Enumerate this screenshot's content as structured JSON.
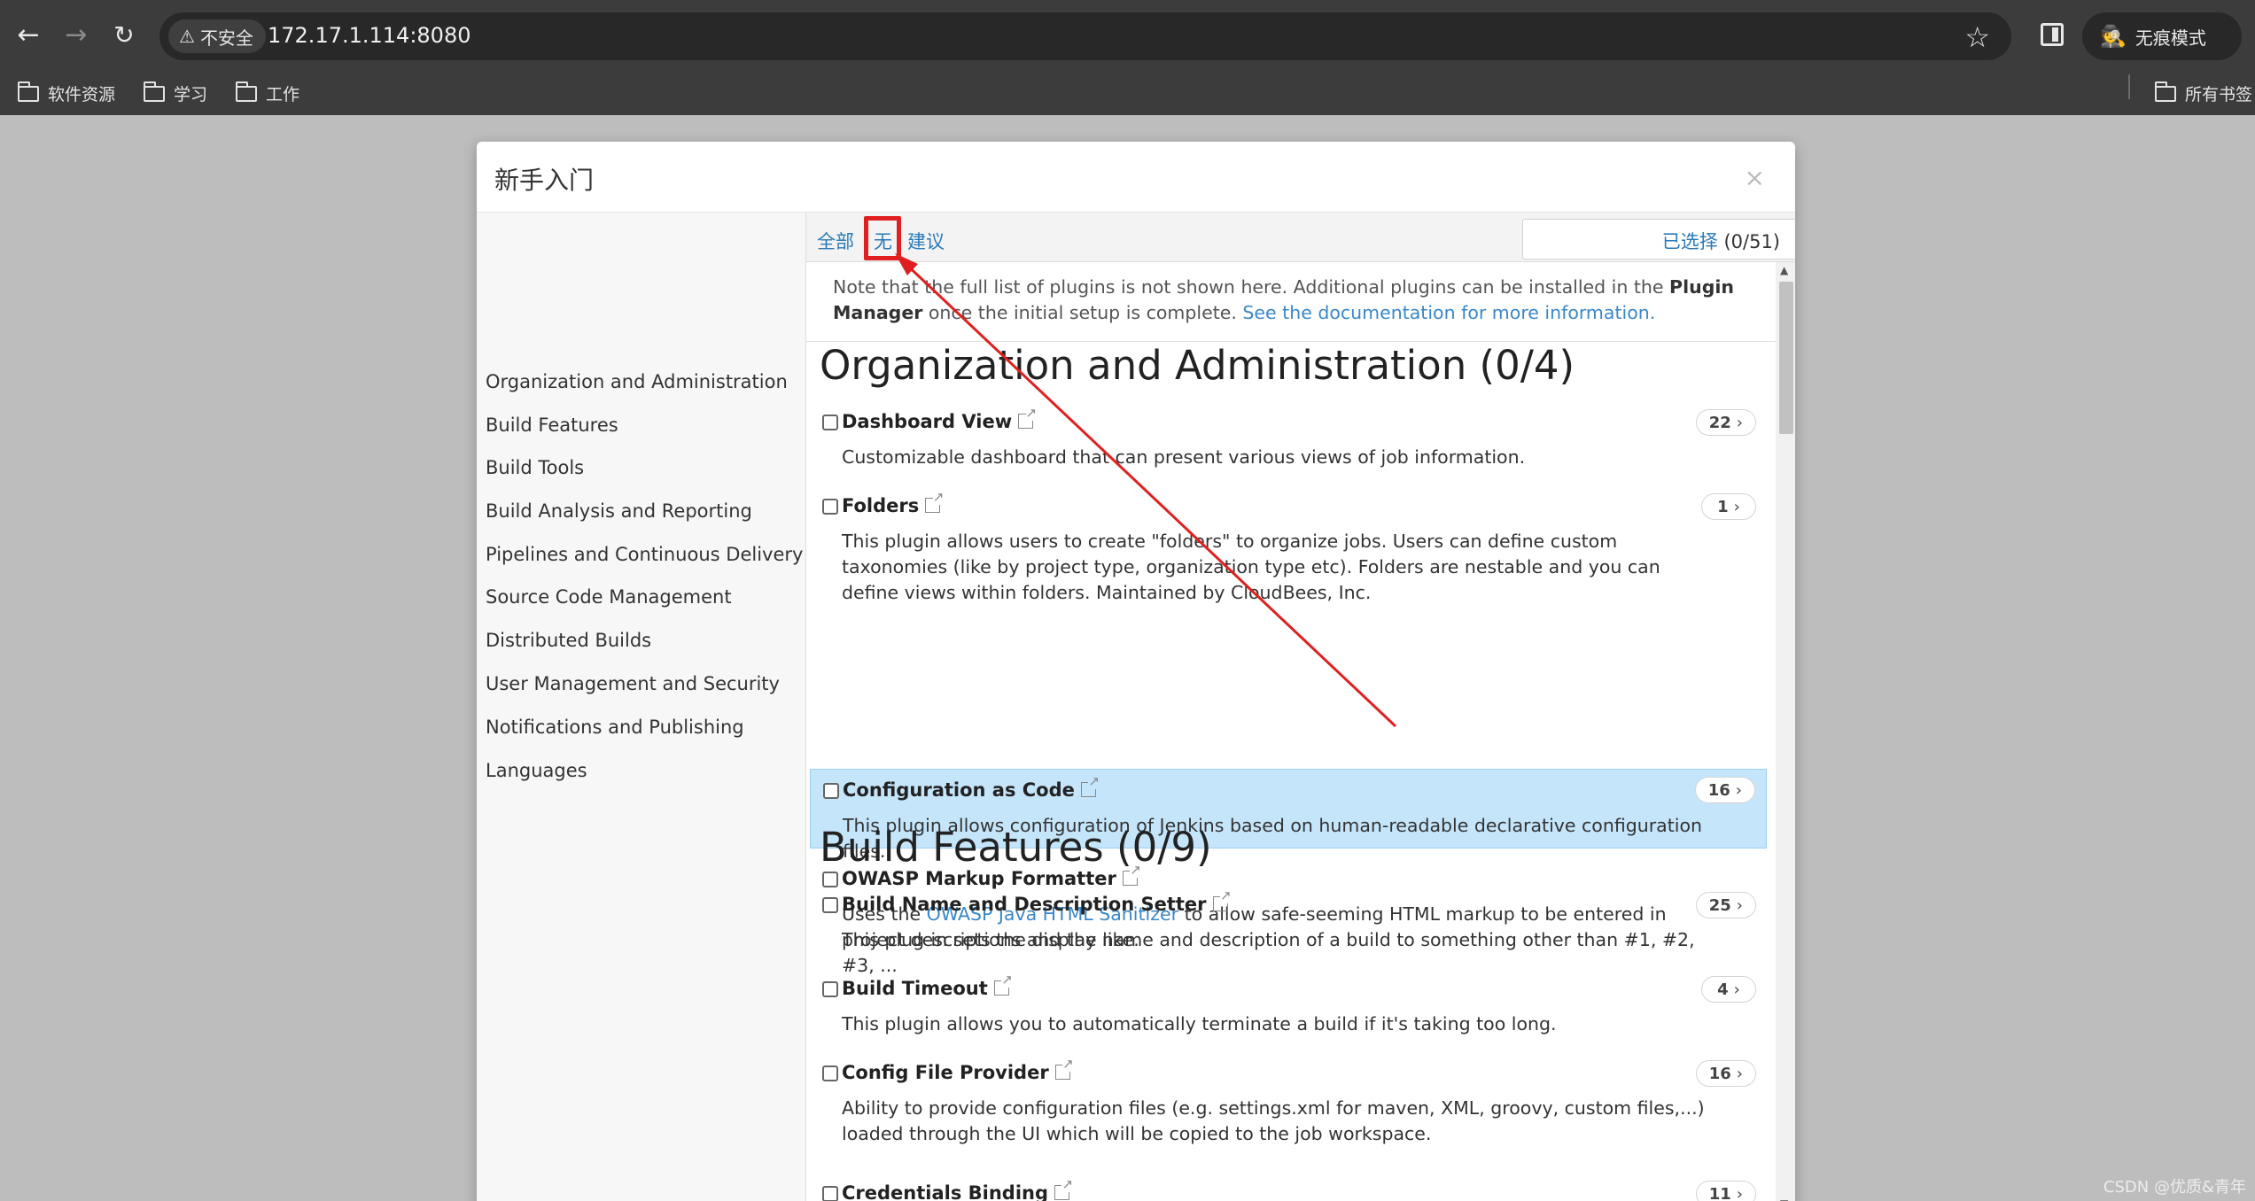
{
  "browser": {
    "url": "172.17.1.114:8080",
    "security_label": "不安全",
    "incognito_label": "无痕模式",
    "bookmarks": [
      "软件资源",
      "学习",
      "工作"
    ],
    "all_bookmarks_label": "所有书签"
  },
  "modal": {
    "title": "新手入门",
    "close_glyph": "×"
  },
  "sidebar": {
    "categories": [
      "Organization and Administration",
      "Build Features",
      "Build Tools",
      "Build Analysis and Reporting",
      "Pipelines and Continuous Delivery",
      "Source Code Management",
      "Distributed Builds",
      "User Management and Security",
      "Notifications and Publishing",
      "Languages"
    ]
  },
  "filter": {
    "all_label": "全部",
    "none_label": "无",
    "suggested_label": "建议",
    "search_value": "",
    "clear_glyph": "×",
    "selected_label": "已选择",
    "selected_count": "(0/51)"
  },
  "note": {
    "text_before": "Note that the full list of plugins is not shown here. Additional plugins can be installed in the ",
    "plugin_manager": "Plugin Manager",
    "text_middle": " once the initial setup is complete. ",
    "doc_link": "See the documentation for more information."
  },
  "sections": [
    {
      "title": "Organization and Administration (0/4)",
      "plugins": [
        {
          "name": "Dashboard View",
          "count": "22",
          "desc": "Customizable dashboard that can present various views of job information."
        },
        {
          "name": "Folders",
          "count": "1",
          "desc": "This plugin allows users to create \"folders\" to organize jobs. Users can define custom taxonomies (like by project type, organization type etc). Folders are nestable and you can define views within folders. Maintained by CloudBees, Inc."
        },
        {
          "name": "Configuration as Code",
          "count": "16",
          "desc": "This plugin allows configuration of Jenkins based on human-readable declarative configuration files."
        },
        {
          "name": "OWASP Markup Formatter",
          "count": "",
          "desc_before": "Uses the ",
          "desc_link": "OWASP Java HTML Sanitizer",
          "desc_after": " to allow safe-seeming HTML markup to be entered in project descriptions and the like."
        }
      ]
    },
    {
      "title": "Build Features (0/9)",
      "plugins": [
        {
          "name": "Build Name and Description Setter",
          "count": "25",
          "desc": "This plug-in sets the display name and description of a build to something other than #1, #2, #3, ..."
        },
        {
          "name": "Build Timeout",
          "count": "4",
          "desc": "This plugin allows you to automatically terminate a build if it's taking too long."
        },
        {
          "name": "Config File Provider",
          "count": "16",
          "desc": "Ability to provide configuration files (e.g. settings.xml for maven, XML, groovy, custom files,...) loaded through the UI which will be copied to the job workspace."
        },
        {
          "name": "Credentials Binding",
          "count": "11",
          "desc": ""
        }
      ]
    }
  ],
  "watermark": "CSDN @优质&青年",
  "annotation_color": "#e02020"
}
